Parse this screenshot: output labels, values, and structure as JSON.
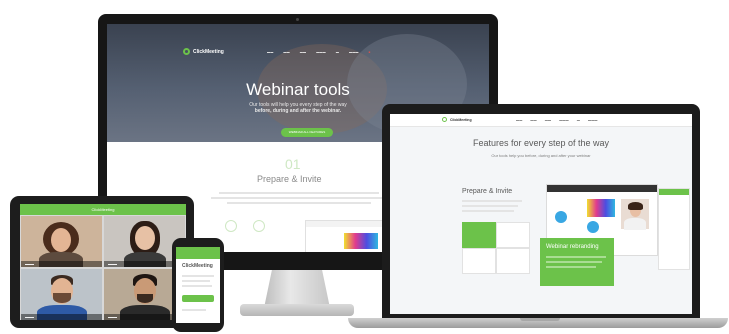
{
  "monitor": {
    "logo_text": "ClickMeeting",
    "hero_title": "Webinar tools",
    "hero_subtitle_line1": "Our tools will help you every step of the way",
    "hero_subtitle_line2": "before, during and after the webinar.",
    "cta_label": "WEBINAR ALL FEATURES",
    "section_number": "01",
    "section_title": "Prepare & Invite"
  },
  "laptop": {
    "logo_text": "ClickMeeting",
    "title": "Features for every step of the way",
    "subtitle": "Our tools help you before, during and after your webinar",
    "section_title": "Prepare & Invite",
    "card_title": "Webinar rebranding"
  },
  "tablet": {
    "header": "ClickMeeting"
  },
  "phone": {
    "logo_text": "ClickMeeting"
  },
  "colors": {
    "brand_green": "#6cc24a",
    "device_black": "#1d1d1d"
  }
}
